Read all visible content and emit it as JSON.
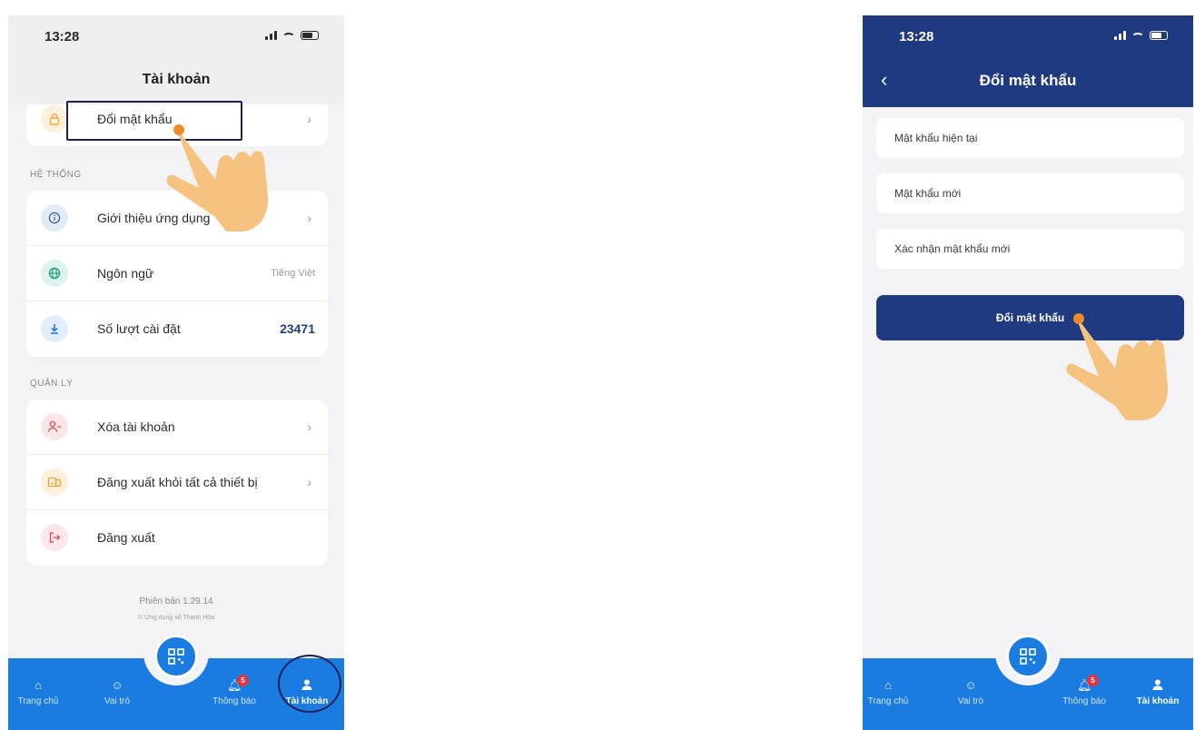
{
  "left_screen": {
    "status_time": "13:28",
    "title": "Tài khoản",
    "change_password_label": "Đổi mật khẩu",
    "system_section": "HỆ THỐNG",
    "about_label": "Giới thiệu ứng dụng",
    "language_label": "Ngôn ngữ",
    "language_value": "Tiếng Việt",
    "installs_label": "Số lượt cài đặt",
    "installs_value": "23471",
    "manage_section": "QUẢN LÝ",
    "delete_account_label": "Xóa tài khoản",
    "logout_all_label": "Đăng xuất khỏi tất cả thiết bị",
    "logout_label": "Đăng xuất",
    "version": "Phiên bản 1.29.14",
    "copyright": "© Ứng dụng số Thanh Hóa"
  },
  "right_screen": {
    "status_time": "13:28",
    "title": "Đổi mật khẩu",
    "current_password_placeholder": "Mật khẩu hiện tại",
    "new_password_placeholder": "Mật khẩu mới",
    "confirm_password_placeholder": "Xác nhận mật khẩu mới",
    "submit_label": "Đổi mật khẩu"
  },
  "tabbar": {
    "home": "Trang chủ",
    "role": "Vai trò",
    "notifications": "Thông báo",
    "notifications_badge": "5",
    "account": "Tài khoản"
  },
  "colors": {
    "tabbar": "#1a7be0",
    "header_dark": "#1f3a80",
    "badge": "#e5323e",
    "annotation": "#1d1f5a",
    "hand": "#f6c27f"
  },
  "icons": [
    "signal-icon",
    "wifi-icon",
    "battery-icon",
    "lock-icon",
    "info-icon",
    "globe-icon",
    "download-icon",
    "user-remove-icon",
    "devices-logout-icon",
    "logout-icon",
    "home-icon",
    "role-icon",
    "qr-icon",
    "bell-icon",
    "user-icon",
    "back-icon",
    "hand-pointer-icon"
  ]
}
